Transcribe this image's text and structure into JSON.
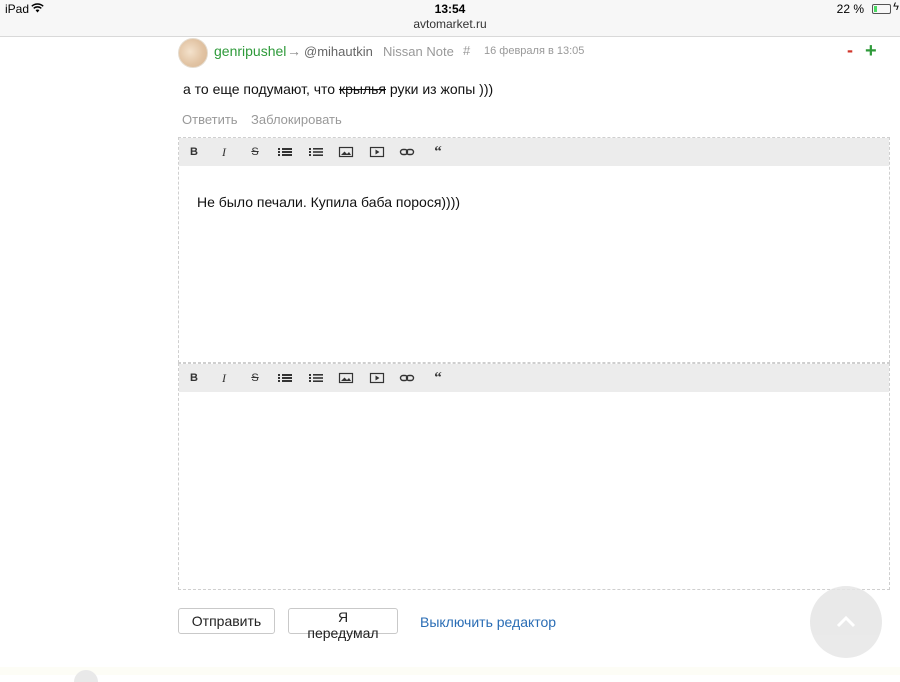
{
  "status_bar": {
    "device": "iPad",
    "time": "13:54",
    "url": "avtomarket.ru",
    "battery_percent": "22 %",
    "battery_level": 0.22
  },
  "comment": {
    "author": "genripushel",
    "arrow": "→",
    "mention": "@mihautkin",
    "car": "Nissan Note",
    "hash": "#",
    "date": "16 февраля в 13:05",
    "vote_minus": "-",
    "vote_plus": "+",
    "text_before": "а то еще подумают, что ",
    "text_struck": "крылья",
    "text_after": " руки из жопы )))",
    "actions": {
      "reply": "Ответить",
      "block": "Заблокировать"
    }
  },
  "editor_toolbar_icons": [
    "bold-icon",
    "italic-icon",
    "strikethrough-icon",
    "bullet-list-icon",
    "numbered-list-icon",
    "image-icon",
    "video-icon",
    "link-icon",
    "quote-icon"
  ],
  "editor_1": {
    "content": "Не было печали. Купила баба порося))))"
  },
  "editor_2": {
    "content": ""
  },
  "buttons": {
    "send": "Отправить",
    "cancel": "Я передумал",
    "disable_editor": "Выключить редактор"
  },
  "colors": {
    "author": "#2e9a3a",
    "link": "#2a6db5",
    "minus": "#d0362b",
    "plus": "#2e9a3a"
  }
}
